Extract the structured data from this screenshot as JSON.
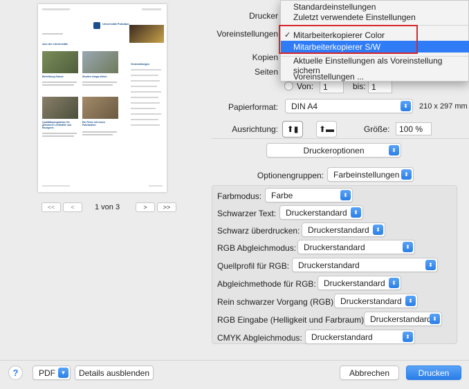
{
  "window": {
    "print_label": "Drucker"
  },
  "menu": {
    "items": [
      {
        "label": "Standardeinstellungen"
      },
      {
        "label": "Zuletzt verwendete Einstellungen"
      },
      {
        "label": "Mitarbeiterkopierer Color",
        "checked": true
      },
      {
        "label": "Mitarbeiterkopierer S/W",
        "selected": true
      },
      {
        "label": "Aktuelle Einstellungen als Voreinstellung sichern"
      },
      {
        "label": "Voreinstellungen ..."
      }
    ],
    "check_glyph": "✓"
  },
  "labels": {
    "printer": "Drucker",
    "presets": "Voreinstellungen",
    "copies": "Kopien",
    "pages": "Seiten",
    "from": "Von:",
    "to": "bis:",
    "paper": "Papierformat:",
    "orientation": "Ausrichtung:",
    "scale": "Größe:"
  },
  "values": {
    "from": "1",
    "to": "1",
    "paper": "DIN A4",
    "paper_size": "210 x 297 mm",
    "scale": "100 %"
  },
  "section_popup": "Druckeroptionen",
  "option_groups": {
    "label": "Optionengruppen:",
    "value": "Farbeinstellungen"
  },
  "settings": [
    {
      "label": "Farbmodus:",
      "value": "Farbe"
    },
    {
      "label": "Schwarzer Text:",
      "value": "Druckerstandard"
    },
    {
      "label": "Schwarz überdrucken:",
      "value": "Druckerstandard"
    },
    {
      "label": "RGB Abgleichmodus:",
      "value": "Druckerstandard"
    },
    {
      "label": "Quellprofil für RGB:",
      "value": "Druckerstandard"
    },
    {
      "label": "Abgleichmethode für RGB:",
      "value": "Druckerstandard"
    },
    {
      "label": "Rein schwarzer Vorgang (RGB):",
      "value": "Druckerstandard"
    },
    {
      "label": "RGB Eingabe (Helligkeit und Farbraum):",
      "value": "Druckerstandard"
    },
    {
      "label": "CMYK Abgleichmodus:",
      "value": "Druckerstandard"
    }
  ],
  "preview": {
    "page_counter": "1 von 3",
    "nav_first": "<<",
    "nav_prev": "<",
    "nav_next": ">",
    "nav_last": ">>",
    "logo": "Universität Potsdam",
    "heading": "Aus der Universität",
    "captions": [
      "Betreibung Klasse",
      "Studien knapp mitten",
      "Qualitätsprogramme für gehobene Lehrkräfte und Neuzgens",
      "Ein Fkom mit neuen Fahrkasiten"
    ],
    "sidebar_title": "Veranstaltungen"
  },
  "footer": {
    "help": "?",
    "pdf": "PDF",
    "details": "Details ausblenden",
    "cancel": "Abbrechen",
    "print": "Drucken"
  },
  "colors": {
    "accent": "#2f7cf6",
    "highlight_box": "#d9252a"
  }
}
